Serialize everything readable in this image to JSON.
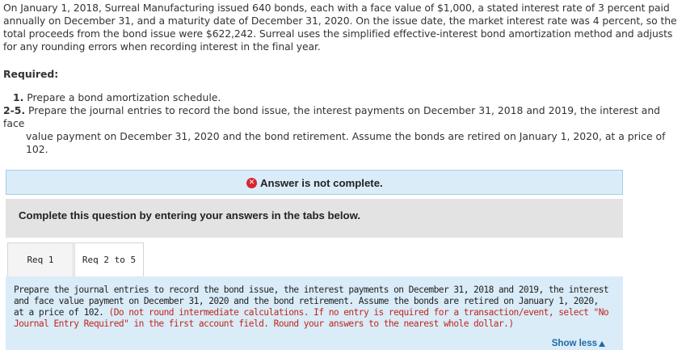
{
  "intro": {
    "text": "On January 1, 2018, Surreal Manufacturing issued 640 bonds, each with a face value of $1,000, a stated interest rate of 3 percent paid annually on December 31, and a maturity date of December 31, 2020. On the issue date, the market interest rate was 4 percent, so the total proceeds from the bond issue were $622,242. Surreal uses the simplified effective-interest bond amortization method and adjusts for any rounding errors when recording interest in the final year."
  },
  "required": {
    "heading": "Required:",
    "items": [
      {
        "number": "1.",
        "text": "Prepare a bond amortization schedule."
      },
      {
        "number": "2-5.",
        "text": "Prepare the journal entries to record the bond issue, the interest payments on December 31, 2018 and 2019,  the interest and face",
        "continuation": "value payment on December 31, 2020 and the bond retirement. Assume the bonds are retired on January 1, 2020, at a price of 102."
      }
    ]
  },
  "alert": {
    "icon": "x-circle-icon",
    "icon_glyph": "✕",
    "text": "Answer is not complete.",
    "bg_color": "#d9ecf8",
    "icon_color": "#d9262e"
  },
  "instruction": {
    "text": "Complete this question by entering your answers in the tabs below."
  },
  "tabs": [
    {
      "label": "Req 1",
      "active": false
    },
    {
      "label": "Req 2 to 5",
      "active": true
    }
  ],
  "panel": {
    "text": "Prepare the journal entries to record the bond issue, the interest payments on December 31, 2018 and 2019,  the interest and face value payment on December 31, 2020 and the bond retirement. Assume the bonds are retired on January 1, 2020, at a price of 102.",
    "note": "(Do not round intermediate calculations. If no entry is required for a transaction/event, select \"No Journal Entry Required\" in the first account field. Round your answers to the nearest whole dollar.)",
    "note_color": "#c0261c",
    "show_less_label": "Show less",
    "show_less_icon": "triangle-up-icon"
  }
}
